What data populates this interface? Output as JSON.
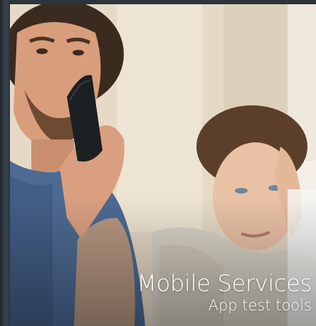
{
  "tile": {
    "title": "Mobile Services",
    "subtitle": "App test tools"
  },
  "colors": {
    "caption_text": "#ffffff",
    "wall": "#e3d6c2",
    "shirt_blue": "#4d6a93",
    "phone": "#1c1f22",
    "sweater": "#d9d3c6"
  }
}
